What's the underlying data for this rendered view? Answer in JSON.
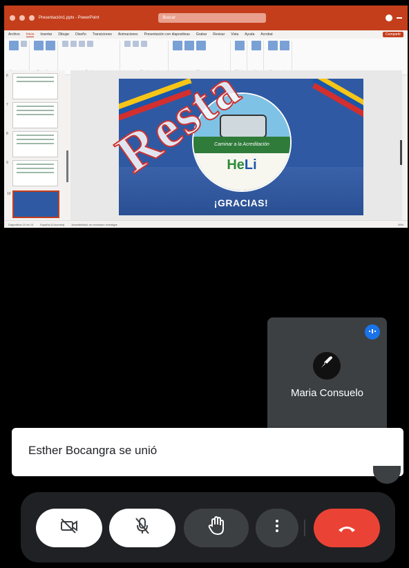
{
  "presentation": {
    "window_title": "Presentación1.pptx - PowerPoint",
    "search_placeholder": "Buscar",
    "menu": [
      "Archivo",
      "Inicio",
      "Insertar",
      "Dibujar",
      "Diseño",
      "Transiciones",
      "Animaciones",
      "Presentación con diapositivas",
      "Grabar",
      "Revisar",
      "Vista",
      "Ayuda",
      "Acrobat"
    ],
    "menu_active": "Inicio",
    "share_label": "Compartir",
    "ribbon_groups": [
      "Portapapeles",
      "Diapositivas",
      "Fuente",
      "Párrafo",
      "Dibujo",
      "Edición",
      "Voz",
      "Complementos"
    ],
    "thumb_numbers": [
      "6",
      "7",
      "8",
      "9",
      "10"
    ],
    "slide": {
      "banner_text": "Caminar a la Acreditación",
      "logo_text": "He",
      "logo_text_accent": "Li",
      "closing_text": "¡GRACIAS!"
    },
    "status": {
      "slide_counter": "Diapositiva 10 de 10",
      "language": "Español (Colombia)",
      "accessibility": "Accesibilidad: es necesario investigar",
      "zoom": "49%"
    }
  },
  "watermark": "Resta",
  "participant": {
    "name": "Maria Consuelo",
    "initial": "✒",
    "badge_icon": "audio-level-icon"
  },
  "notification": {
    "text": "Esther Bocangra se unió"
  },
  "controls": {
    "camera_icon": "camera-off-icon",
    "mic_icon": "mic-off-icon",
    "hand_icon": "raise-hand-icon",
    "more_icon": "more-vert-icon",
    "hangup_icon": "hang-up-icon",
    "hangup_color": "#ea4335"
  }
}
